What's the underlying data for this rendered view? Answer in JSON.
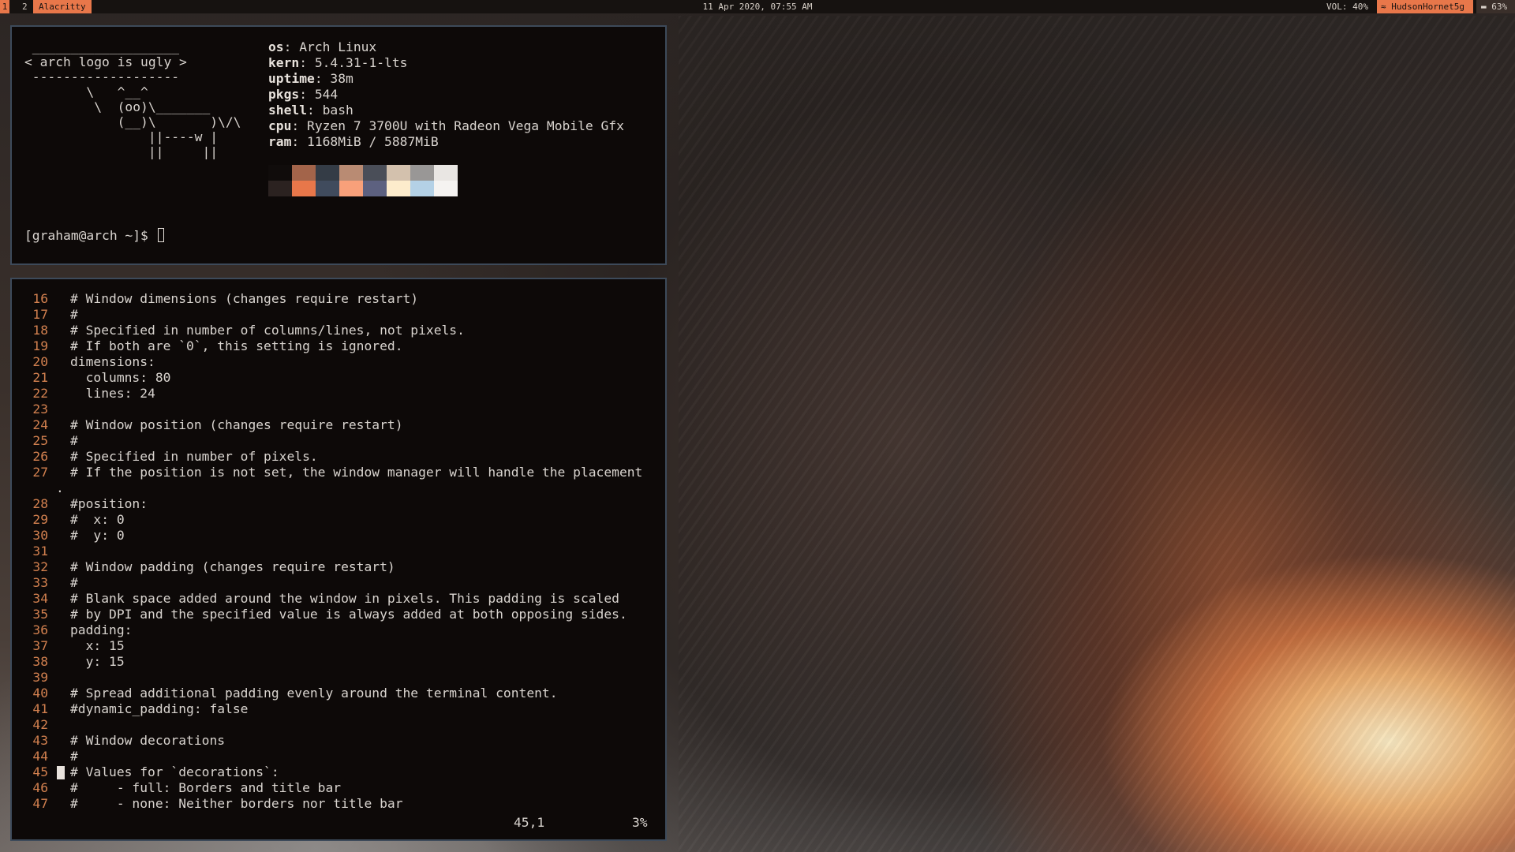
{
  "topbar": {
    "workspaces": [
      "1",
      "2"
    ],
    "window_title": "Alacritty",
    "clock": "11 Apr 2020, 07:55 AM",
    "volume": "VOL: 40%",
    "wifi_icon": "wifi-icon",
    "wifi": "HudsonHornet5g",
    "battery_icon": "battery-icon",
    "battery": "63%"
  },
  "fetch": {
    "cowsay": " ___________________\n< arch logo is ugly >\n -------------------\n        \\   ^__^\n         \\  (oo)\\_______\n            (__)\\       )\\/\\\n                ||----w |\n                ||     ||",
    "info": [
      {
        "key": "os",
        "value": ": Arch Linux"
      },
      {
        "key": "kern",
        "value": ": 5.4.31-1-lts"
      },
      {
        "key": "uptime",
        "value": ": 38m"
      },
      {
        "key": "pkgs",
        "value": ": 544"
      },
      {
        "key": "shell",
        "value": ": bash"
      },
      {
        "key": "cpu",
        "value": ": Ryzen 7 3700U with Radeon Vega Mobile Gfx"
      },
      {
        "key": "ram",
        "value": ": 1168MiB / 5887MiB"
      }
    ],
    "palette_top": [
      "#100c0b",
      "#a3644a",
      "#343c46",
      "#b98b73",
      "#4a4e58",
      "#d3c1ad",
      "#999796",
      "#e9e6e3"
    ],
    "palette_bottom": [
      "#2b2220",
      "#e8774a",
      "#404b5d",
      "#f8a07a",
      "#5d6180",
      "#fdeccc",
      "#b4d1e6",
      "#f5f3f1"
    ],
    "prompt": "[graham@arch ~]$ "
  },
  "editor": {
    "lines": [
      {
        "n": "16",
        "t": "# Window dimensions (changes require restart)"
      },
      {
        "n": "17",
        "t": "#"
      },
      {
        "n": "18",
        "t": "# Specified in number of columns/lines, not pixels."
      },
      {
        "n": "19",
        "t": "# If both are `0`, this setting is ignored."
      },
      {
        "n": "20",
        "t": "dimensions:"
      },
      {
        "n": "21",
        "t": "  columns: 80"
      },
      {
        "n": "22",
        "t": "  lines: 24"
      },
      {
        "n": "23",
        "t": ""
      },
      {
        "n": "24",
        "t": "# Window position (changes require restart)"
      },
      {
        "n": "25",
        "t": "#"
      },
      {
        "n": "26",
        "t": "# Specified in number of pixels."
      },
      {
        "n": "27",
        "t": "# If the position is not set, the window manager will handle the placement"
      },
      {
        "n": "",
        "t": "",
        "wrap": "."
      },
      {
        "n": "28",
        "t": "#position:"
      },
      {
        "n": "29",
        "t": "#  x: 0"
      },
      {
        "n": "30",
        "t": "#  y: 0"
      },
      {
        "n": "31",
        "t": ""
      },
      {
        "n": "32",
        "t": "# Window padding (changes require restart)"
      },
      {
        "n": "33",
        "t": "#"
      },
      {
        "n": "34",
        "t": "# Blank space added around the window in pixels. This padding is scaled"
      },
      {
        "n": "35",
        "t": "# by DPI and the specified value is always added at both opposing sides."
      },
      {
        "n": "36",
        "t": "padding:"
      },
      {
        "n": "37",
        "t": "  x: 15"
      },
      {
        "n": "38",
        "t": "  y: 15"
      },
      {
        "n": "39",
        "t": ""
      },
      {
        "n": "40",
        "t": "# Spread additional padding evenly around the terminal content."
      },
      {
        "n": "41",
        "t": "#dynamic_padding: false"
      },
      {
        "n": "42",
        "t": ""
      },
      {
        "n": "43",
        "t": "# Window decorations"
      },
      {
        "n": "44",
        "t": "#"
      },
      {
        "n": "45",
        "t": "# Values for `decorations`:",
        "cursor": true
      },
      {
        "n": "46",
        "t": "#     - full: Borders and title bar"
      },
      {
        "n": "47",
        "t": "#     - none: Neither borders nor title bar"
      }
    ],
    "ruler": "45,1",
    "percent": "3%"
  }
}
